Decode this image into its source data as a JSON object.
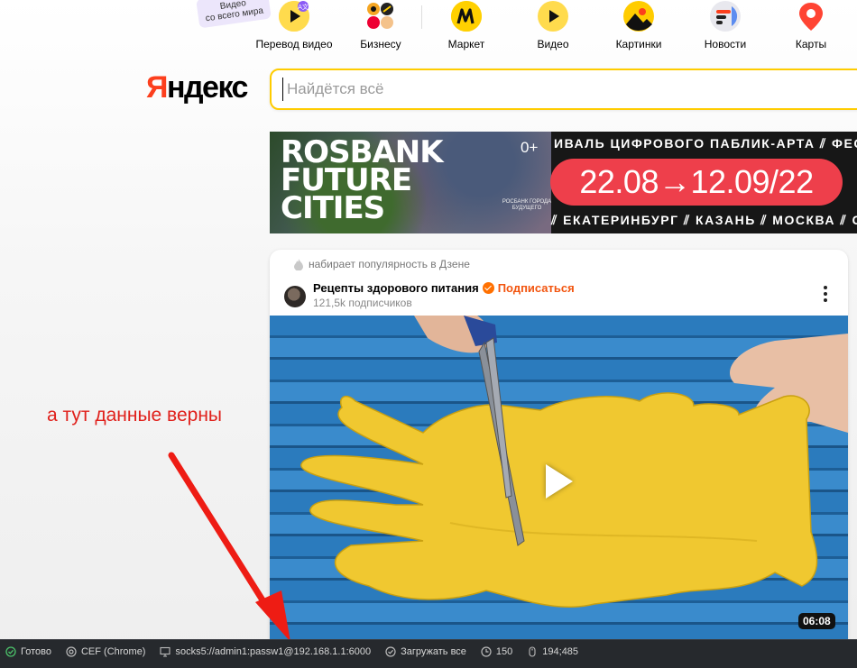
{
  "promo_badge": {
    "line1": "Видео",
    "line2": "со всего мира"
  },
  "services": [
    {
      "label": "Перевод видео",
      "icon": "video-translate-icon"
    },
    {
      "label": "Бизнесу",
      "icon": "business-icon"
    },
    {
      "label": "Маркет",
      "icon": "market-icon"
    },
    {
      "label": "Видео",
      "icon": "video-icon"
    },
    {
      "label": "Картинки",
      "icon": "images-icon"
    },
    {
      "label": "Новости",
      "icon": "news-icon"
    },
    {
      "label": "Карты",
      "icon": "maps-icon"
    }
  ],
  "logo": {
    "first": "Я",
    "rest": "ндекс"
  },
  "search": {
    "placeholder": "Найдётся всё",
    "value": ""
  },
  "banner": {
    "brand": "ROSBANK FUTURE CITIES",
    "small_caption": "РОСБАНК ГОРОДА БУДУЩЕГО",
    "age": "0+",
    "ticker_top": "ИВАЛЬ ЦИФРОВОГО ПАБЛИК-АРТА ⫽ ФЕСТИ",
    "dates": "22.08→12.09/22",
    "ticker_bottom": "⫽ ЕКАТЕРИНБУРГ ⫽ КАЗАНЬ ⫽ МОСКВА ⫽ С"
  },
  "zen_card": {
    "trend_text": "набирает популярность в Дзене",
    "channel": "Рецепты здорового питания",
    "subscribe": "Подписаться",
    "subscribers": "121,5k подписчиков",
    "duration": "06:08"
  },
  "annotation": {
    "text": "а тут данные верны"
  },
  "status_bar": {
    "ready": "Готово",
    "engine": "CEF (Chrome)",
    "proxy": "socks5://admin1:passw1@192.168.1.1:6000",
    "load": "Загружать все",
    "timer": "150",
    "mouse": "194;485"
  },
  "colors": {
    "yandex_red": "#fc3f1d",
    "search_border": "#ffcc00",
    "subscribe": "#f2550f",
    "annotation": "#e0201b",
    "status_bg": "#26292d",
    "banner_dates_bg": "#ee3f4b"
  }
}
